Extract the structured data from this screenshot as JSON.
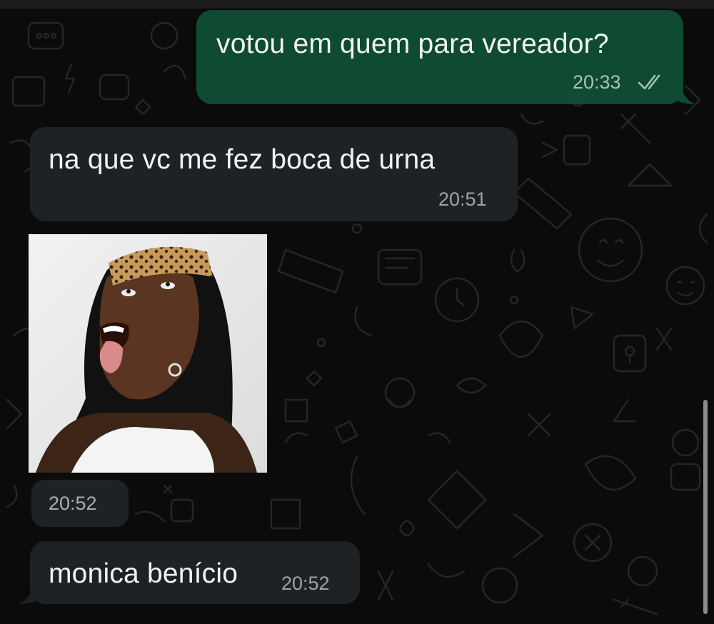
{
  "messages": [
    {
      "direction": "outgoing",
      "text": "votou em quem para vereador?",
      "time": "20:33",
      "status": "read-double-check-icon"
    },
    {
      "direction": "incoming",
      "text": "na que vc me fez boca de urna",
      "time": "20:51"
    },
    {
      "direction": "incoming",
      "type": "sticker",
      "time": "20:52"
    },
    {
      "direction": "incoming",
      "text": "monica benício",
      "time": "20:52"
    }
  ],
  "colors": {
    "outgoing_bubble": "#0f4a33",
    "incoming_bubble": "#1f2224",
    "background": "#0b0b0b",
    "timestamp": "#9ea3a6"
  }
}
